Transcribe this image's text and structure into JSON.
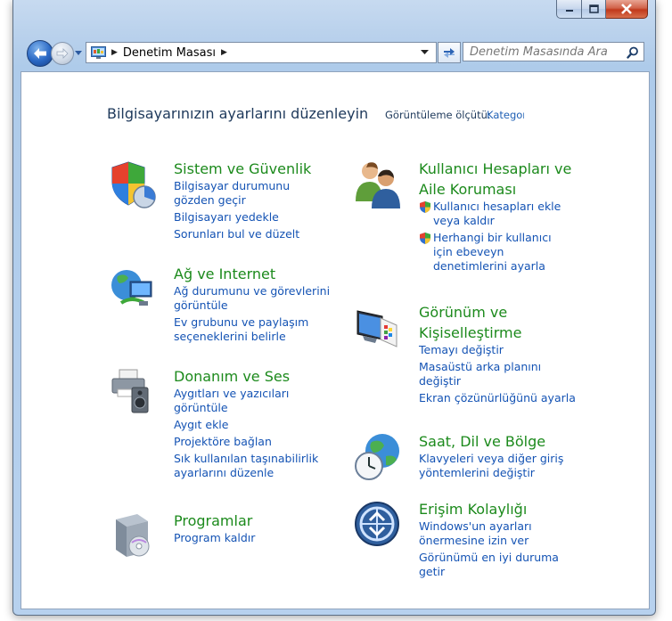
{
  "window": {
    "address": {
      "segment": "Denetim Masası"
    },
    "search": {
      "placeholder": "Denetim Masasında Ara"
    }
  },
  "header": {
    "title": "Bilgisayarınızın ayarlarını düzenleyin",
    "view_by_label": "Görüntüleme ölçütü:",
    "view_by_value": "Kategori"
  },
  "categories": [
    {
      "title": [
        "Sistem ve Güvenlik"
      ],
      "icon": "shield-icon",
      "links": [
        [
          "Bilgisayar durumunu",
          "gözden geçir"
        ],
        [
          "Bilgisayarı yedekle"
        ],
        [
          "Sorunları bul ve düzelt"
        ]
      ]
    },
    {
      "title": [
        "Ağ ve Internet"
      ],
      "icon": "network-globe-icon",
      "links": [
        [
          "Ağ durumunu ve görevlerini",
          "görüntüle"
        ],
        [
          "Ev grubunu ve paylaşım",
          "seçeneklerini belirle"
        ]
      ]
    },
    {
      "title": [
        "Donanım ve Ses"
      ],
      "icon": "printer-speaker-icon",
      "links": [
        [
          "Aygıtları ve yazıcıları",
          "görüntüle"
        ],
        [
          "Aygıt ekle"
        ],
        [
          "Projektöre bağlan"
        ],
        [
          "Sık kullanılan taşınabilirlik",
          "ayarlarını düzenle"
        ]
      ]
    },
    {
      "title": [
        "Programlar"
      ],
      "icon": "programs-box-icon",
      "links": [
        [
          "Program kaldır"
        ]
      ]
    },
    {
      "title": [
        "Kullanıcı Hesapları ve",
        "Aile Koruması"
      ],
      "icon": "users-icon",
      "links": [
        [
          "Kullanıcı hesapları ekle",
          "veya kaldır"
        ],
        [
          "Herhangi bir kullanıcı",
          "için ebeveyn",
          "denetimlerini ayarla"
        ]
      ]
    },
    {
      "title": [
        "Görünüm ve",
        "Kişiselleştirme"
      ],
      "icon": "monitor-palette-icon",
      "links": [
        [
          "Temayı değiştir"
        ],
        [
          "Masaüstü arka planını",
          "değiştir"
        ],
        [
          "Ekran çözünürlüğünü ayarla"
        ]
      ]
    },
    {
      "title": [
        "Saat, Dil ve Bölge"
      ],
      "icon": "clock-globe-icon",
      "links": [
        [
          "Klavyeleri veya diğer giriş",
          "yöntemlerini değiştir"
        ]
      ]
    },
    {
      "title": [
        "Erişim Kolaylığı"
      ],
      "icon": "accessibility-icon",
      "links": [
        [
          "Windows'un ayarları",
          "önermesine izin ver"
        ],
        [
          "Görünümü en iyi duruma",
          "getir"
        ]
      ]
    }
  ]
}
